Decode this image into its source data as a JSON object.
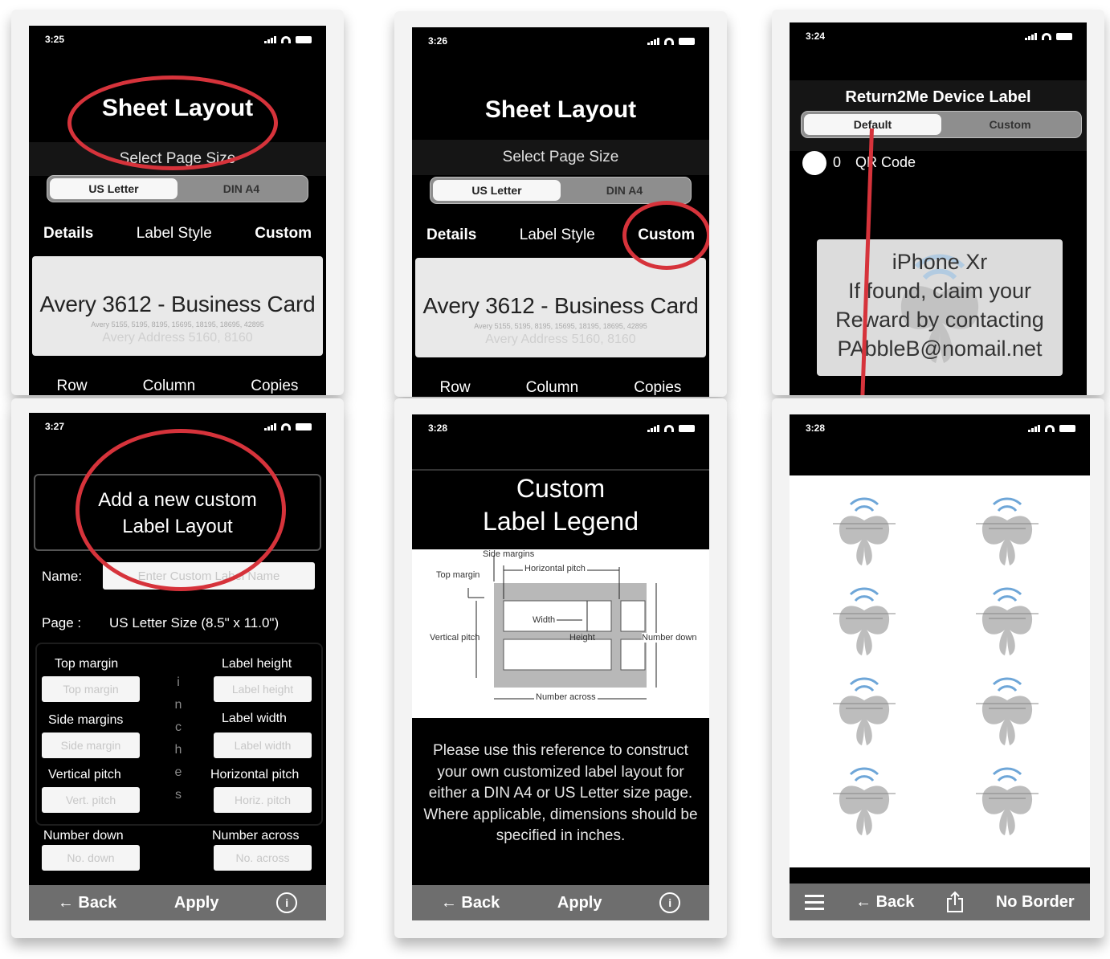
{
  "colors": {
    "highlight_ring": "#d6333b",
    "phone_background": "#000000",
    "segment_selected": "#f7f7f7",
    "toolbar": "#6e6e6e"
  },
  "screens": {
    "s1": {
      "time": "3:25",
      "title": "Sheet Layout",
      "subtitle": "Select Page Size",
      "segments": [
        "US Letter",
        "DIN A4"
      ],
      "selected_segment": "US Letter",
      "tabs": [
        "Details",
        "Label Style",
        "Custom"
      ],
      "picker_main": "Avery 3612 - Business Card",
      "picker_sub": "Avery 5155, 5195, 8195, 15695, 18195, 18695, 42895",
      "picker_ghost": "Avery Address 5160, 8160",
      "bottom_tabs": [
        "Row",
        "Column",
        "Copies"
      ],
      "highlight": "title"
    },
    "s2": {
      "time": "3:26",
      "title": "Sheet Layout",
      "subtitle": "Select Page Size",
      "segments": [
        "US Letter",
        "DIN A4"
      ],
      "selected_segment": "US Letter",
      "tabs": [
        "Details",
        "Label Style",
        "Custom"
      ],
      "picker_main": "Avery 3612 - Business Card",
      "picker_sub": "Avery 5155, 5195, 8195, 15695, 18195, 18695, 42895",
      "picker_ghost": "Avery Address 5160, 8160",
      "bottom_tabs": [
        "Row",
        "Column",
        "Copies"
      ],
      "highlight": "Custom tab"
    },
    "s3": {
      "time": "3:24",
      "title": "Return2Me Device Label",
      "segments": [
        "Default",
        "Custom"
      ],
      "selected_segment": "Default",
      "toggle_value": "0",
      "toggle_label": "QR Code",
      "preview_lines": [
        "iPhone Xr",
        "If found, claim your",
        "Reward by contacting",
        "PAbbleB@nomail.net"
      ]
    },
    "s4": {
      "time": "3:27",
      "heading_line1": "Add a new custom",
      "heading_line2": "Label Layout",
      "name_label": "Name:",
      "name_placeholder": "Enter Custom Label Name",
      "page_label": "Page :",
      "page_value": "US Letter Size (8.5\" x 11.0\")",
      "fields": {
        "top_margin": {
          "label": "Top margin",
          "placeholder": "Top margin"
        },
        "label_height": {
          "label": "Label height",
          "placeholder": "Label height"
        },
        "side_margins": {
          "label": "Side margins",
          "placeholder": "Side margin"
        },
        "label_width": {
          "label": "Label width",
          "placeholder": "Label width"
        },
        "vertical_pitch": {
          "label": "Vertical pitch",
          "placeholder": "Vert. pitch"
        },
        "horizontal_pitch": {
          "label": "Horizontal pitch",
          "placeholder": "Horiz. pitch"
        },
        "number_down": {
          "label": "Number down",
          "placeholder": "No. down"
        },
        "number_across": {
          "label": "Number across",
          "placeholder": "No. across"
        }
      },
      "units_letters": [
        "i",
        "n",
        "c",
        "h",
        "e",
        "s"
      ],
      "toolbar": {
        "back": "← Back",
        "apply": "Apply",
        "info": "i"
      }
    },
    "s5": {
      "time": "3:28",
      "title_line1": "Custom",
      "title_line2": "Label Legend",
      "diagram_labels": {
        "side_margins": "Side margins",
        "horizontal_pitch": "Horizontal pitch",
        "top_margin": "Top margin",
        "width": "Width",
        "vertical_pitch": "Vertical pitch",
        "height": "Height",
        "number_down": "Number down",
        "number_across": "Number across"
      },
      "description": "Please use this reference to construct your own customized label layout for either a DIN A4 or US Letter size page. Where applicable, dimensions should be specified in inches.",
      "toolbar": {
        "back": "← Back",
        "apply": "Apply",
        "info": "i"
      }
    },
    "s6": {
      "time": "3:28",
      "label_rows": 4,
      "label_columns": 2,
      "toolbar": {
        "menu_icon": "hamburger-icon",
        "back": "← Back",
        "share_icon": "share-icon",
        "border": "No Border"
      }
    }
  }
}
